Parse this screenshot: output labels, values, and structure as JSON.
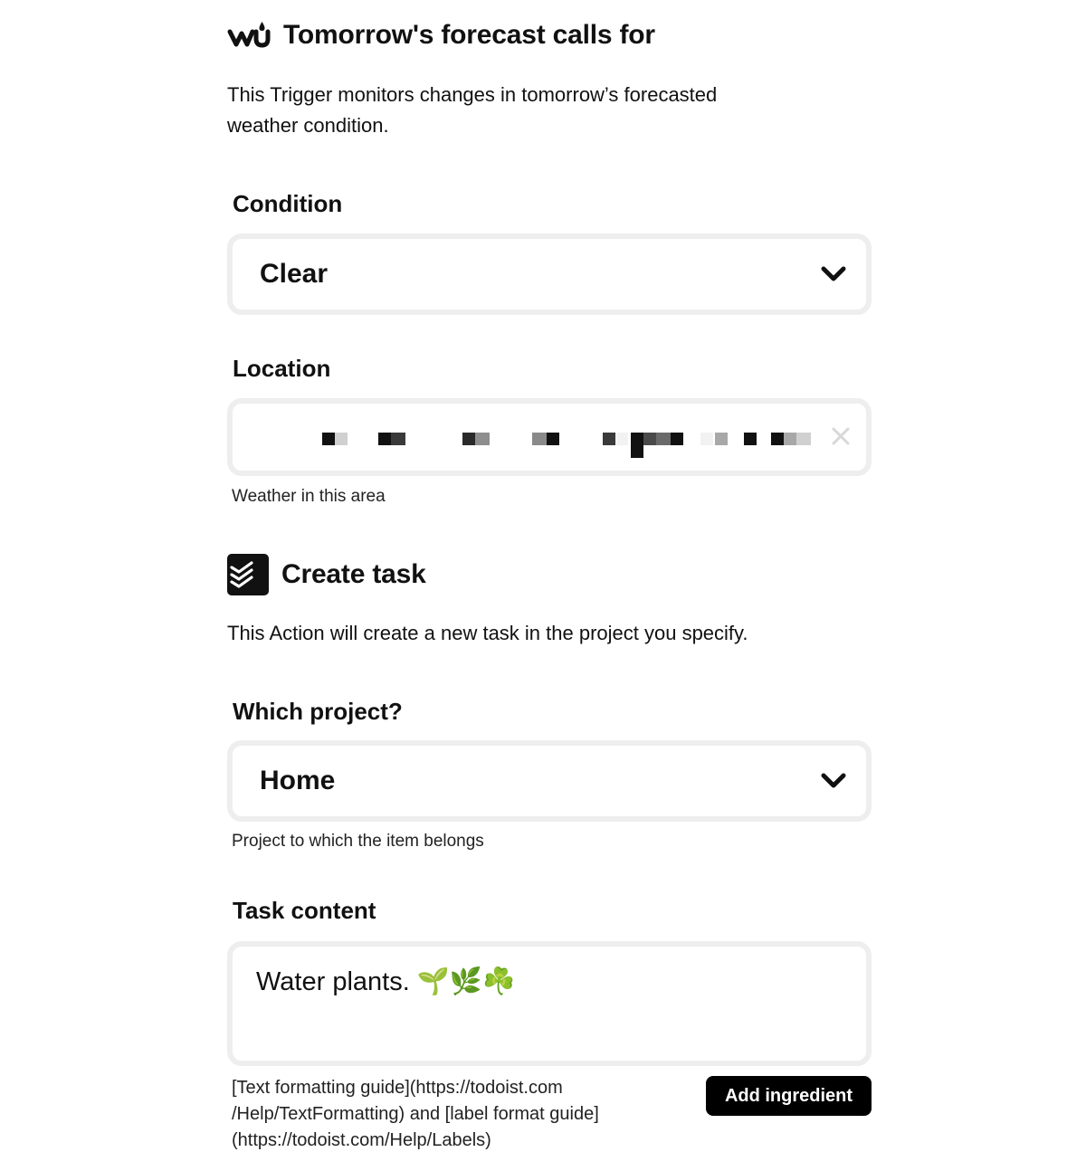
{
  "trigger": {
    "service_icon": "wunderground-logo-icon",
    "title": "Tomorrow's forecast calls for",
    "description_line1": "This Trigger monitors changes in tomorrow’s forecasted",
    "description_line2": "weather condition.",
    "fields": {
      "condition": {
        "label": "Condition",
        "value": "Clear",
        "icon": "chevron-down-icon"
      },
      "location": {
        "label": "Location",
        "value": "[redacted]",
        "helper": "Weather in this area",
        "clear_icon": "close-icon"
      }
    }
  },
  "action": {
    "service_icon": "todoist-logo-icon",
    "title": "Create task",
    "description": "This Action will create a new task in the project you specify.",
    "fields": {
      "project": {
        "label": "Which project?",
        "value": "Home",
        "helper": "Project to which the item belongs",
        "icon": "chevron-down-icon"
      },
      "task_content": {
        "label": "Task content",
        "value": "Water plants. 🌱🌿☘️",
        "guide_line1": "[Text formatting guide](https://todoist.com",
        "guide_line2": "/Help/TextFormatting) and [label format guide]",
        "guide_line3": "(https://todoist.com/Help/Labels)",
        "add_ingredient_label": "Add ingredient"
      }
    }
  },
  "colors": {
    "field_border": "#eeeeee",
    "button_bg": "#000000",
    "text": "#111111"
  }
}
